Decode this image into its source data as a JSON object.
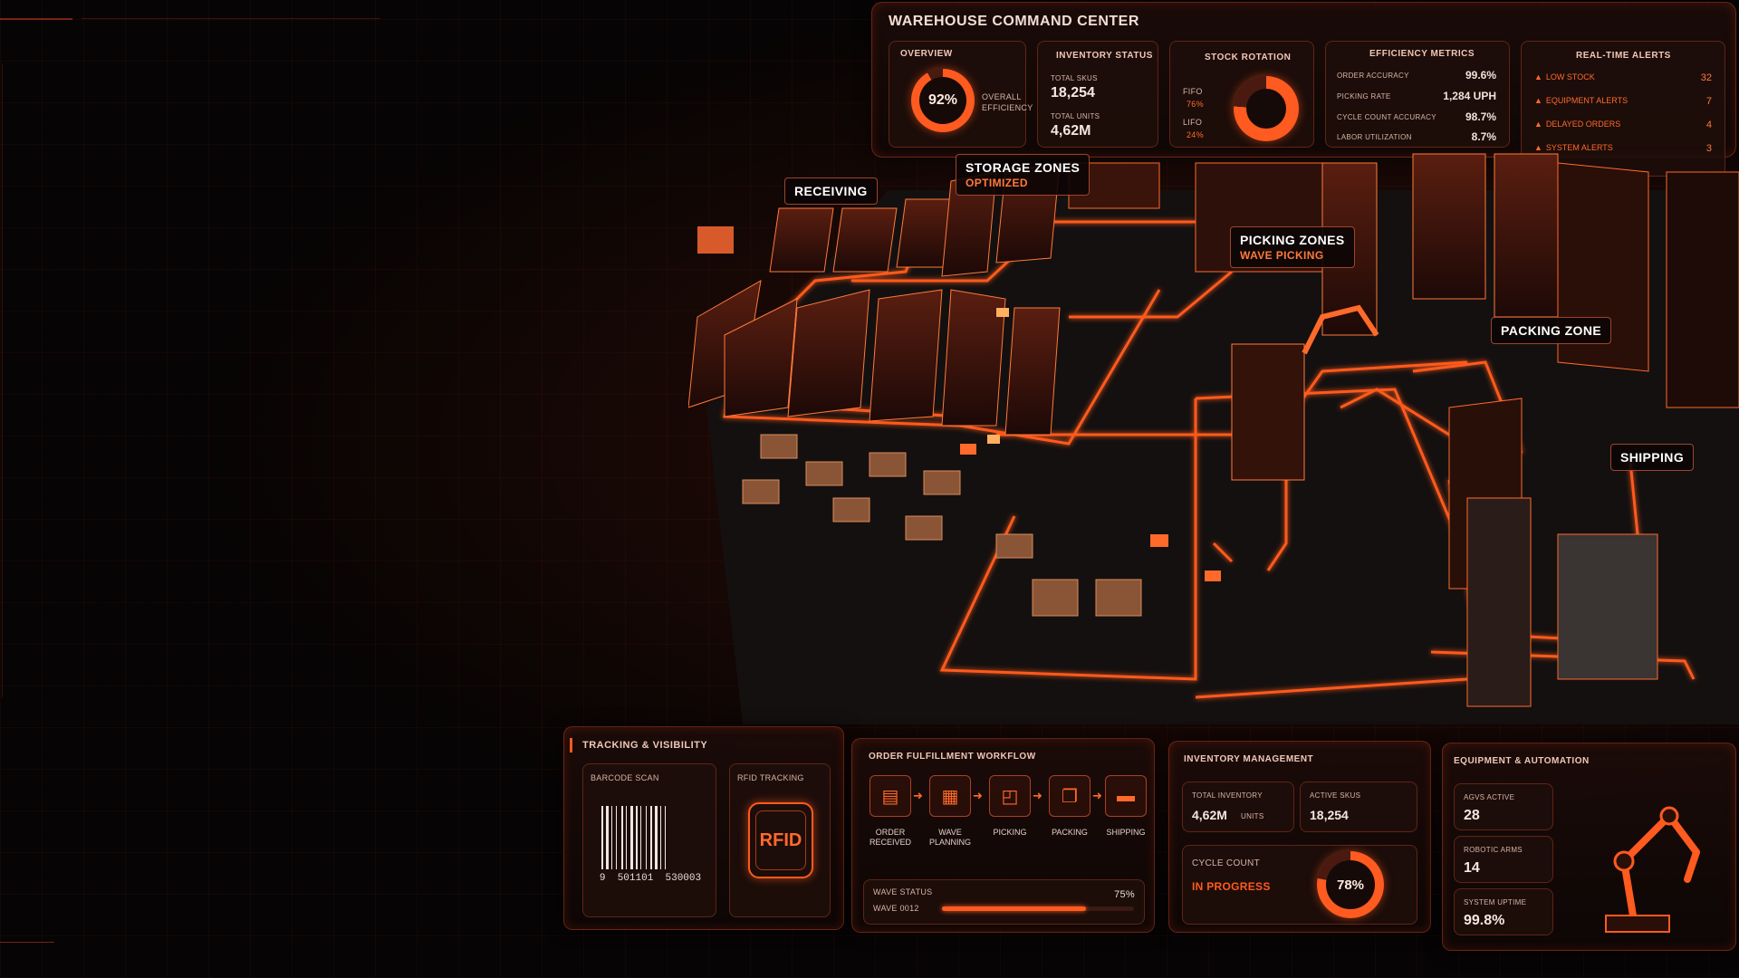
{
  "app": {
    "title": "WAREHOUSE COMMAND CENTER"
  },
  "colors": {
    "accent": "#ff5a1f",
    "panel": "#1a0b08",
    "text": "#e8dcd6"
  },
  "overview": {
    "title": "OVERVIEW",
    "efficiency_value": "92%",
    "efficiency_fraction": 0.92,
    "efficiency_label_1": "OVERALL",
    "efficiency_label_2": "EFFICIENCY"
  },
  "inventory_status": {
    "title": "INVENTORY STATUS",
    "total_skus_label": "TOTAL SKUS",
    "total_skus": "18,254",
    "total_units_label": "TOTAL UNITS",
    "total_units": "4,62M"
  },
  "stock_rotation": {
    "title": "STOCK ROTATION",
    "fifo_label": "FIFO",
    "fifo_value": "76%",
    "fifo_fraction": 0.76,
    "lifo_label": "LIFO",
    "lifo_value": "24%"
  },
  "efficiency_metrics": {
    "title": "EFFICIENCY METRICS",
    "rows": [
      {
        "label": "ORDER ACCURACY",
        "value": "99.6%"
      },
      {
        "label": "PICKING RATE",
        "value": "1,284 UPH"
      },
      {
        "label": "CYCLE COUNT ACCURACY",
        "value": "98.7%"
      },
      {
        "label": "LABOR UTILIZATION",
        "value": "8.7%"
      }
    ]
  },
  "alerts": {
    "title": "REAL-TIME ALERTS",
    "rows": [
      {
        "label": "LOW STOCK",
        "count": "32"
      },
      {
        "label": "EQUIPMENT ALERTS",
        "count": "7"
      },
      {
        "label": "DELAYED ORDERS",
        "count": "4"
      },
      {
        "label": "SYSTEM ALERTS",
        "count": "3"
      }
    ]
  },
  "zones": {
    "receiving": "RECEIVING",
    "storage": "STORAGE ZONES",
    "storage_sub": "OPTIMIZED",
    "picking": "PICKING ZONES",
    "picking_sub": "WAVE PICKING",
    "packing": "PACKING ZONE",
    "shipping": "SHIPPING"
  },
  "tracking": {
    "title": "TRACKING & VISIBILITY",
    "barcode_label": "BARCODE SCAN",
    "barcode_number": "9  501101  530003",
    "rfid_label": "RFID TRACKING",
    "rfid_text": "RFID"
  },
  "workflow": {
    "title": "ORDER FULFILLMENT WORKFLOW",
    "steps": [
      {
        "label": "ORDER RECEIVED",
        "icon": "document-icon"
      },
      {
        "label": "WAVE PLANNING",
        "icon": "chart-icon"
      },
      {
        "label": "PICKING",
        "icon": "picker-icon"
      },
      {
        "label": "PACKING",
        "icon": "box-icon"
      },
      {
        "label": "SHIPPING",
        "icon": "truck-icon"
      }
    ],
    "wave_status_label": "WAVE STATUS",
    "wave_id": "WAVE 0012",
    "wave_progress": "75%",
    "wave_fraction": 0.75
  },
  "inventory_mgmt": {
    "title": "INVENTORY MANAGEMENT",
    "total_inventory_label": "TOTAL INVENTORY",
    "total_inventory_value": "4,62M",
    "total_inventory_unit": "UNITS",
    "active_skus_label": "ACTIVE SKUS",
    "active_skus_value": "18,254",
    "cycle_count_label": "CYCLE COUNT",
    "cycle_count_status": "IN PROGRESS",
    "cycle_count_value": "78%",
    "cycle_count_fraction": 0.78
  },
  "equipment": {
    "title": "EQUIPMENT & AUTOMATION",
    "agvs_label": "AGVS ACTIVE",
    "agvs_value": "28",
    "arms_label": "ROBOTIC ARMS",
    "arms_value": "14",
    "uptime_label": "SYSTEM UPTIME",
    "uptime_value": "99.8%"
  }
}
